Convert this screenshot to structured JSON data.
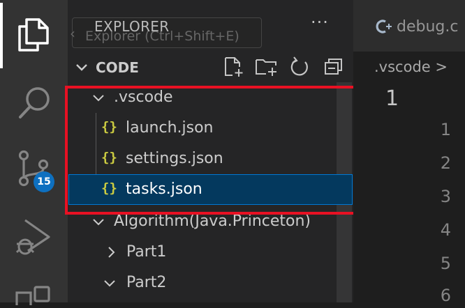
{
  "activity_bar": {
    "items": [
      {
        "name": "explorer",
        "icon": "files-icon",
        "active": true
      },
      {
        "name": "search",
        "icon": "search-icon"
      },
      {
        "name": "source-control",
        "icon": "source-control-icon",
        "badge": "15"
      },
      {
        "name": "run-debug",
        "icon": "run-debug-icon"
      },
      {
        "name": "extensions",
        "icon": "extensions-icon"
      }
    ]
  },
  "sidebar": {
    "title": "EXPLORER",
    "tooltip": "Explorer (Ctrl+Shift+E)",
    "more_actions": "···",
    "section": {
      "title": "CODE",
      "actions": [
        "new-file-icon",
        "new-folder-icon",
        "refresh-icon",
        "collapse-all-icon"
      ]
    },
    "tree": [
      {
        "label": ".vscode",
        "type": "folder",
        "expanded": true
      },
      {
        "label": "launch.json",
        "type": "json-file"
      },
      {
        "label": "settings.json",
        "type": "json-file"
      },
      {
        "label": "tasks.json",
        "type": "json-file",
        "selected": true
      },
      {
        "label": "Algorithm(Java.Princeton)",
        "type": "folder",
        "expanded": true
      },
      {
        "label": "Part1",
        "type": "folder",
        "expanded": false
      },
      {
        "label": "Part2",
        "type": "folder",
        "expanded": true
      }
    ],
    "json_icon_glyph": "{}"
  },
  "editor": {
    "tab": {
      "label": "debug.c",
      "icon": "c-file-icon"
    },
    "breadcrumb": ".vscode >",
    "current_line": "1",
    "line_numbers": [
      "1",
      "2",
      "3",
      "4",
      "5",
      "6"
    ]
  },
  "colors": {
    "highlight": "#e81123",
    "selection": "#04395e",
    "focus_border": "#0078d4",
    "badge": "#0e70c0",
    "json_icon": "#cbcb41"
  }
}
